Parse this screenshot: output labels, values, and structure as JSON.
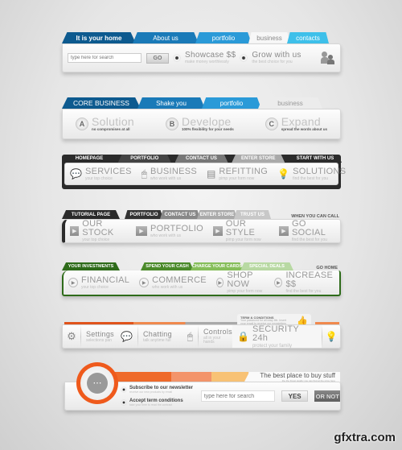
{
  "header1": {
    "tabs": [
      "It is your home",
      "About us",
      "portfolio",
      "business",
      "contacts"
    ],
    "search_placeholder": "type here for search",
    "go_label": "GO",
    "items": [
      {
        "title": "Showcase $$",
        "sub": "make money worthlessly"
      },
      {
        "title": "Grow with us",
        "sub": "the best choice for you"
      }
    ],
    "icon": "users-icon"
  },
  "header2": {
    "tabs": [
      "CORE BUSINESS",
      "Shake you",
      "portfolio",
      "business"
    ],
    "items": [
      {
        "badge": "A",
        "title": "Solution",
        "sub": "no compromises at all"
      },
      {
        "badge": "B",
        "title": "Develope",
        "sub": "100% flexibility for your needs"
      },
      {
        "badge": "C",
        "title": "Expand",
        "sub": "spread the words about us"
      }
    ]
  },
  "header3": {
    "tabs": [
      "HOMEPAGE",
      "PORTFOLIO",
      "CONTACT US",
      "ENTER STORE",
      "START WITH US"
    ],
    "items": [
      {
        "icon": "chat-bubble-icon",
        "title": "SERVICES",
        "sub": "your top choice"
      },
      {
        "icon": "mouse-icon",
        "title": "BUSINESS",
        "sub": "who work with us"
      },
      {
        "icon": "document-icon",
        "title": "REFITTING",
        "sub": "pimp your form now"
      },
      {
        "icon": "lightbulb-icon",
        "title": "SOLUTIONS",
        "sub": "find the best for you"
      }
    ]
  },
  "header4": {
    "tabs": [
      "TUTORIAL PAGE",
      "PORTFOLIO",
      "CONTACT US",
      "ENTER STORE",
      "TRUST US"
    ],
    "right_label": "WHEN YOU CAN CALL",
    "items": [
      {
        "title": "OUR STOCK",
        "sub": "your top choice"
      },
      {
        "title": "PORTFOLIO",
        "sub": "who work with us"
      },
      {
        "title": "OUR STYLE",
        "sub": "pimp your form now"
      },
      {
        "title": "GO SOCIAL",
        "sub": "find the best for you"
      }
    ]
  },
  "header5": {
    "tabs": [
      "YOUR INVESTMENTS",
      "SPEND YOUR CASH",
      "CHARGE YOUR CARDS",
      "SPECIAL DEALS"
    ],
    "right_label": "GO HOME",
    "items": [
      {
        "title": "FINANCIAL",
        "sub": "your top choice"
      },
      {
        "title": "COMMERCE",
        "sub": "who work with us"
      },
      {
        "title": "SHOP NOW",
        "sub": "pimp your form now"
      },
      {
        "title": "INCREASE $$",
        "sub": "find the best for you"
      }
    ]
  },
  "header6": {
    "terms_title": "TERM & CONDITIONS",
    "terms_text": "Your password for all easy life. Insert your email to receive our newsletters",
    "items": [
      {
        "title": "Settings",
        "sub": "selections pan"
      },
      {
        "title": "Chatting",
        "sub": "talk anytime full"
      },
      {
        "title": "Controls",
        "sub": "all in your hands"
      }
    ],
    "security_title": "SECURITY 24h",
    "security_sub": "protect your family"
  },
  "header7": {
    "tagline": "The best place to buy stuff",
    "tagline_sub": "the the finest quality you can find at the price here",
    "options": [
      {
        "title": "Subscribe to our newsletter",
        "sub": "receive our new products by email"
      },
      {
        "title": "Accept term conditions",
        "sub": "take your time to read the contract"
      }
    ],
    "search_placeholder": "type here for search",
    "yes_label": "YES",
    "no_label": "OR NOT"
  },
  "watermark": "gfxtra.com"
}
